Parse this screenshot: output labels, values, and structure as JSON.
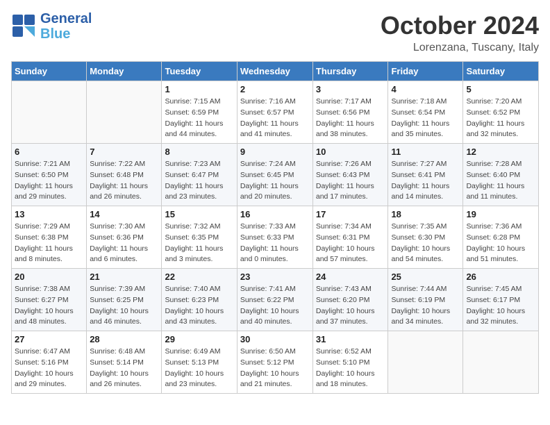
{
  "header": {
    "logo_line1": "General",
    "logo_line2": "Blue",
    "title": "October 2024",
    "subtitle": "Lorenzana, Tuscany, Italy"
  },
  "weekdays": [
    "Sunday",
    "Monday",
    "Tuesday",
    "Wednesday",
    "Thursday",
    "Friday",
    "Saturday"
  ],
  "weeks": [
    [
      {
        "day": "",
        "info": ""
      },
      {
        "day": "",
        "info": ""
      },
      {
        "day": "1",
        "info": "Sunrise: 7:15 AM\nSunset: 6:59 PM\nDaylight: 11 hours and 44 minutes."
      },
      {
        "day": "2",
        "info": "Sunrise: 7:16 AM\nSunset: 6:57 PM\nDaylight: 11 hours and 41 minutes."
      },
      {
        "day": "3",
        "info": "Sunrise: 7:17 AM\nSunset: 6:56 PM\nDaylight: 11 hours and 38 minutes."
      },
      {
        "day": "4",
        "info": "Sunrise: 7:18 AM\nSunset: 6:54 PM\nDaylight: 11 hours and 35 minutes."
      },
      {
        "day": "5",
        "info": "Sunrise: 7:20 AM\nSunset: 6:52 PM\nDaylight: 11 hours and 32 minutes."
      }
    ],
    [
      {
        "day": "6",
        "info": "Sunrise: 7:21 AM\nSunset: 6:50 PM\nDaylight: 11 hours and 29 minutes."
      },
      {
        "day": "7",
        "info": "Sunrise: 7:22 AM\nSunset: 6:48 PM\nDaylight: 11 hours and 26 minutes."
      },
      {
        "day": "8",
        "info": "Sunrise: 7:23 AM\nSunset: 6:47 PM\nDaylight: 11 hours and 23 minutes."
      },
      {
        "day": "9",
        "info": "Sunrise: 7:24 AM\nSunset: 6:45 PM\nDaylight: 11 hours and 20 minutes."
      },
      {
        "day": "10",
        "info": "Sunrise: 7:26 AM\nSunset: 6:43 PM\nDaylight: 11 hours and 17 minutes."
      },
      {
        "day": "11",
        "info": "Sunrise: 7:27 AM\nSunset: 6:41 PM\nDaylight: 11 hours and 14 minutes."
      },
      {
        "day": "12",
        "info": "Sunrise: 7:28 AM\nSunset: 6:40 PM\nDaylight: 11 hours and 11 minutes."
      }
    ],
    [
      {
        "day": "13",
        "info": "Sunrise: 7:29 AM\nSunset: 6:38 PM\nDaylight: 11 hours and 8 minutes."
      },
      {
        "day": "14",
        "info": "Sunrise: 7:30 AM\nSunset: 6:36 PM\nDaylight: 11 hours and 6 minutes."
      },
      {
        "day": "15",
        "info": "Sunrise: 7:32 AM\nSunset: 6:35 PM\nDaylight: 11 hours and 3 minutes."
      },
      {
        "day": "16",
        "info": "Sunrise: 7:33 AM\nSunset: 6:33 PM\nDaylight: 11 hours and 0 minutes."
      },
      {
        "day": "17",
        "info": "Sunrise: 7:34 AM\nSunset: 6:31 PM\nDaylight: 10 hours and 57 minutes."
      },
      {
        "day": "18",
        "info": "Sunrise: 7:35 AM\nSunset: 6:30 PM\nDaylight: 10 hours and 54 minutes."
      },
      {
        "day": "19",
        "info": "Sunrise: 7:36 AM\nSunset: 6:28 PM\nDaylight: 10 hours and 51 minutes."
      }
    ],
    [
      {
        "day": "20",
        "info": "Sunrise: 7:38 AM\nSunset: 6:27 PM\nDaylight: 10 hours and 48 minutes."
      },
      {
        "day": "21",
        "info": "Sunrise: 7:39 AM\nSunset: 6:25 PM\nDaylight: 10 hours and 46 minutes."
      },
      {
        "day": "22",
        "info": "Sunrise: 7:40 AM\nSunset: 6:23 PM\nDaylight: 10 hours and 43 minutes."
      },
      {
        "day": "23",
        "info": "Sunrise: 7:41 AM\nSunset: 6:22 PM\nDaylight: 10 hours and 40 minutes."
      },
      {
        "day": "24",
        "info": "Sunrise: 7:43 AM\nSunset: 6:20 PM\nDaylight: 10 hours and 37 minutes."
      },
      {
        "day": "25",
        "info": "Sunrise: 7:44 AM\nSunset: 6:19 PM\nDaylight: 10 hours and 34 minutes."
      },
      {
        "day": "26",
        "info": "Sunrise: 7:45 AM\nSunset: 6:17 PM\nDaylight: 10 hours and 32 minutes."
      }
    ],
    [
      {
        "day": "27",
        "info": "Sunrise: 6:47 AM\nSunset: 5:16 PM\nDaylight: 10 hours and 29 minutes."
      },
      {
        "day": "28",
        "info": "Sunrise: 6:48 AM\nSunset: 5:14 PM\nDaylight: 10 hours and 26 minutes."
      },
      {
        "day": "29",
        "info": "Sunrise: 6:49 AM\nSunset: 5:13 PM\nDaylight: 10 hours and 23 minutes."
      },
      {
        "day": "30",
        "info": "Sunrise: 6:50 AM\nSunset: 5:12 PM\nDaylight: 10 hours and 21 minutes."
      },
      {
        "day": "31",
        "info": "Sunrise: 6:52 AM\nSunset: 5:10 PM\nDaylight: 10 hours and 18 minutes."
      },
      {
        "day": "",
        "info": ""
      },
      {
        "day": "",
        "info": ""
      }
    ]
  ]
}
